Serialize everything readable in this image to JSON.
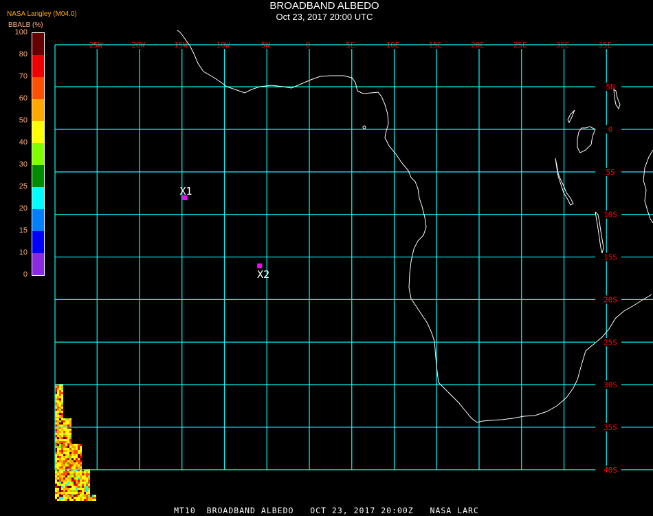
{
  "header": {
    "title": "BROADBAND ALBEDO",
    "subtitle": "Oct 23, 2017 20:00 UTC",
    "source": "NASA Langley (M04.0)"
  },
  "colorbar": {
    "units_label": "BBALB (%)",
    "tick_labels": [
      "100",
      "80",
      "70",
      "60",
      "50",
      "40",
      "30",
      "25",
      "20",
      "15",
      "10",
      "0"
    ],
    "colors": [
      "#660000",
      "#f00000",
      "#ff5000",
      "#ffa800",
      "#ffff00",
      "#80ff00",
      "#008c00",
      "#00ffff",
      "#0080ff",
      "#0000ff",
      "#8a2be2"
    ]
  },
  "map": {
    "grid_color": "#00ffff",
    "label_color": "#ff0000",
    "coast_color": "#ffffff",
    "lon_labels": [
      "25W",
      "20W",
      "15W",
      "10W",
      "5W",
      "0",
      "5E",
      "10E",
      "15E",
      "20E",
      "25E",
      "30E",
      "35E"
    ],
    "lat_labels": [
      "5N",
      "0",
      "5S",
      "10S",
      "15S",
      "20S",
      "25S",
      "30S",
      "35S",
      "40S"
    ],
    "markers": [
      {
        "label": "X1",
        "lon": -14.7,
        "lat": -8.0,
        "color": "#ff00ff"
      },
      {
        "label": "X2",
        "lon": -5.9,
        "lat": -16.0,
        "color": "#ff00ff"
      }
    ]
  },
  "footer": {
    "text": "MT10  BROADBAND ALBEDO   OCT 23, 2017 20:00Z   NASA LARC"
  }
}
